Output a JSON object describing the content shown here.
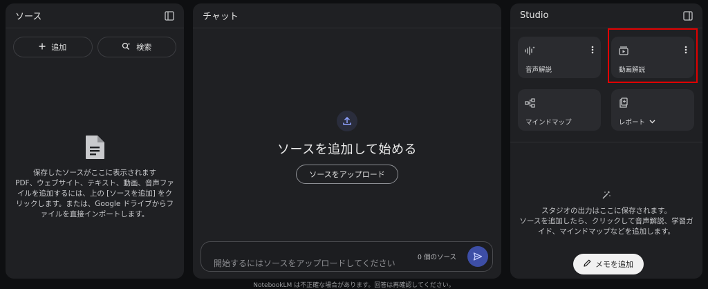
{
  "sources": {
    "title": "ソース",
    "add_label": "追加",
    "search_label": "検索",
    "empty_title": "保存したソースがここに表示されます",
    "empty_body": "PDF、ウェブサイト、テキスト、動画、音声ファイルを追加するには、上の [ソースを追加] をクリックします。または、Google ドライブからファイルを直接インポートします。"
  },
  "chat": {
    "title": "チャット",
    "headline": "ソースを追加して始める",
    "upload_label": "ソースをアップロード",
    "input_placeholder": "開始するにはソースをアップロードしてください",
    "source_count": "0 個のソース"
  },
  "studio": {
    "title": "Studio",
    "cards": [
      {
        "label": "音声解説",
        "icon": "audio-wave-icon"
      },
      {
        "label": "動画解説",
        "icon": "video-overview-icon"
      },
      {
        "label": "マインドマップ",
        "icon": "mind-map-icon"
      },
      {
        "label": "レポート",
        "icon": "report-icon"
      }
    ],
    "empty_line1": "スタジオの出力はここに保存されます。",
    "empty_line2": "ソースを追加したら、クリックして音声解説、学習ガイド、マインドマップなどを追加します。",
    "memo_label": "メモを追加"
  },
  "footer": "NotebookLM は不正確な場合があります。回答は再確認してください。",
  "colors": {
    "background": "#0e0f11",
    "panel": "#1f2023",
    "card": "#2a2b2f",
    "send_button": "#3d4ea6",
    "highlight": "#e10000"
  }
}
